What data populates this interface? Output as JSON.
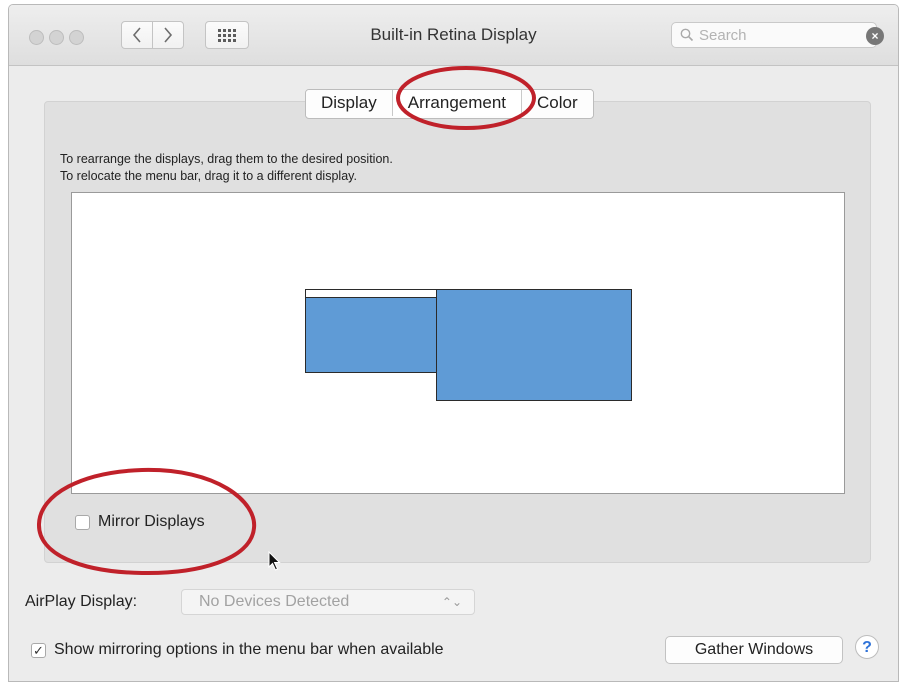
{
  "window": {
    "title": "Built-in Retina Display",
    "search_placeholder": "Search"
  },
  "toolbar": {
    "back_icon": "chevron-left-icon",
    "forward_icon": "chevron-right-icon",
    "show_all_icon": "grid-icon"
  },
  "tabs": [
    {
      "label": "Display",
      "selected": false
    },
    {
      "label": "Arrangement",
      "selected": true
    },
    {
      "label": "Color",
      "selected": false
    }
  ],
  "arrangement": {
    "instruction_1": "To rearrange the displays, drag them to the desired position.",
    "instruction_2": "To relocate the menu bar, drag it to a different display.",
    "display_color": "#5f9bd6"
  },
  "mirror": {
    "label": "Mirror Displays",
    "checked": false
  },
  "airplay": {
    "label": "AirPlay Display:",
    "value": "No Devices Detected"
  },
  "show_mirroring": {
    "label": "Show mirroring options in the menu bar when available",
    "checked": true,
    "check_glyph": "✓"
  },
  "buttons": {
    "gather": "Gather Windows",
    "help": "?"
  },
  "annotation_color": "#c0212a"
}
